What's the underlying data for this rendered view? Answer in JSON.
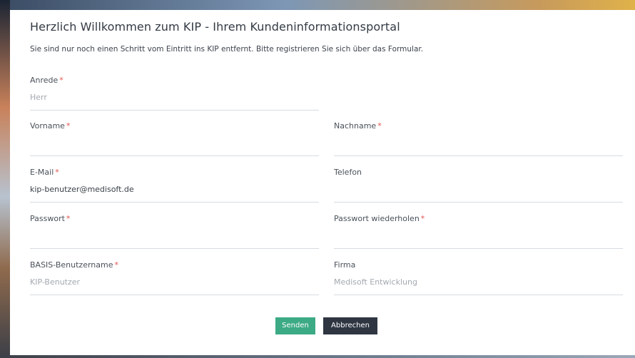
{
  "page": {
    "title": "Herzlich Willkommen zum KIP - Ihrem Kundeninformationsportal",
    "subtitle": "Sie sind nur noch einen Schritt vom Eintritt ins KIP entfernt. Bitte registrieren Sie sich über das Formular."
  },
  "form": {
    "required_marker": "*",
    "anrede": {
      "label": "Anrede",
      "value": "Herr"
    },
    "vorname": {
      "label": "Vorname",
      "value": ""
    },
    "nachname": {
      "label": "Nachname",
      "value": ""
    },
    "email": {
      "label": "E-Mail",
      "value": "kip-benutzer@medisoft.de"
    },
    "telefon": {
      "label": "Telefon",
      "value": ""
    },
    "passwort": {
      "label": "Passwort",
      "value": ""
    },
    "passwort_wdh": {
      "label": "Passwort wiederholen",
      "value": ""
    },
    "basis_user": {
      "label": "BASIS-Benutzername",
      "placeholder": "KIP-Benutzer"
    },
    "firma": {
      "label": "Firma",
      "placeholder": "Medisoft Entwicklung"
    }
  },
  "buttons": {
    "send": "Senden",
    "cancel": "Abbrechen"
  },
  "colors": {
    "required": "#e2534e",
    "send_button": "#3daa86",
    "cancel_button": "#2f3642"
  }
}
